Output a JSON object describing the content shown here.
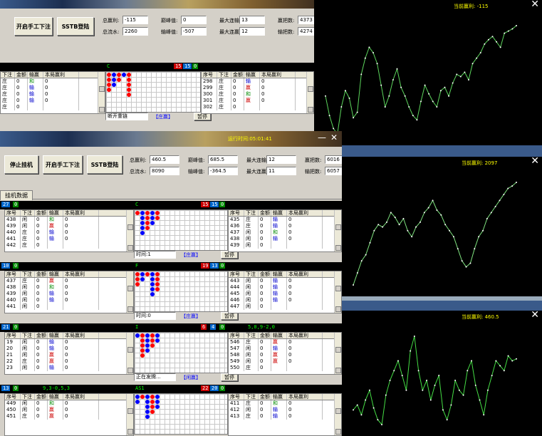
{
  "w1": {
    "buttons": [
      "开启手工下注",
      "SSTB登陆"
    ],
    "stats": [
      {
        "l": "总赢利:",
        "v": "-115"
      },
      {
        "l": "巅峰值:",
        "v": "0"
      },
      {
        "l": "最大连输:",
        "v": "13"
      },
      {
        "l": "赢把数:",
        "v": "4373"
      },
      {
        "l": "总流水:",
        "v": "2260"
      },
      {
        "l": "输峰值:",
        "v": "-507"
      },
      {
        "l": "最大连赢:",
        "v": "12"
      },
      {
        "l": "输把数:",
        "v": "4274"
      }
    ],
    "sections": [
      {
        "left_title": "",
        "cols": [
          "下注",
          "金额",
          "输赢",
          "本局赢利"
        ],
        "rows": [
          [
            "庄",
            "0",
            "和",
            "0"
          ],
          [
            "庄",
            "0",
            "输",
            "0"
          ],
          [
            "庄",
            "0",
            "输",
            "0"
          ],
          [
            "庄",
            "0",
            "输",
            "0"
          ],
          [
            "庄",
            "0",
            "",
            ""
          ]
        ],
        "mid_label": "C",
        "n1": "15",
        "n2": "15",
        "n3": "0",
        "status": "断开重链",
        "bet": "【庄赢】",
        "pause": "暂停",
        "right_title": "",
        "rcols": [
          "序号",
          "下注",
          "金额",
          "输赢",
          "本局赢利"
        ],
        "rrows": [
          [
            "298",
            "庄",
            "0",
            "输",
            "0"
          ],
          [
            "299",
            "庄",
            "0",
            "赢",
            "0"
          ],
          [
            "300",
            "庄",
            "0",
            "和",
            "0"
          ],
          [
            "301",
            "庄",
            "0",
            "赢",
            "0"
          ],
          [
            "302",
            "庄",
            "0",
            "",
            ""
          ]
        ]
      }
    ]
  },
  "w2": {
    "title": "运行时间:05:01:41",
    "buttons": [
      "停止挂机",
      "开启手工下注",
      "SSTB登陆"
    ],
    "stats": [
      {
        "l": "总赢利:",
        "v": "460.5"
      },
      {
        "l": "巅峰值:",
        "v": "685.5"
      },
      {
        "l": "最大连输:",
        "v": "12"
      },
      {
        "l": "赢把数:",
        "v": "6016"
      },
      {
        "l": "总流水:",
        "v": "8090"
      },
      {
        "l": "输峰值:",
        "v": "-364.5"
      },
      {
        "l": "最大连赢:",
        "v": "11"
      },
      {
        "l": "输把数:",
        "v": "6057"
      }
    ],
    "tab": "挂机数据",
    "sections": [
      {
        "left_badge": "27",
        "left_badge2": "0",
        "cols": [
          "序号",
          "下注",
          "金额",
          "输赢",
          "本局赢利"
        ],
        "rows": [
          [
            "438",
            "闲",
            "0",
            "和",
            "0"
          ],
          [
            "439",
            "闲",
            "0",
            "赢",
            "0"
          ],
          [
            "440",
            "庄",
            "0",
            "输",
            "0"
          ],
          [
            "441",
            "庄",
            "0",
            "输",
            "0"
          ],
          [
            "442",
            "庄",
            "0",
            "",
            ""
          ]
        ],
        "mid_label": "C",
        "n1": "15",
        "n2": "15",
        "n3": "0",
        "status": "时间:1",
        "bet": "【庄赢】",
        "pause": "暂停",
        "rcols": [
          "序号",
          "下注",
          "金额",
          "输赢",
          "本局赢利"
        ],
        "rrows": [
          [
            "435",
            "庄",
            "0",
            "输",
            "0"
          ],
          [
            "436",
            "庄",
            "0",
            "输",
            "0"
          ],
          [
            "437",
            "闲",
            "0",
            "和",
            "0"
          ],
          [
            "438",
            "闲",
            "0",
            "输",
            "0"
          ],
          [
            "439",
            "闲",
            "0",
            "",
            ""
          ]
        ]
      },
      {
        "left_badge": "10",
        "left_badge2": "0",
        "cols": [
          "序号",
          "下注",
          "金额",
          "输赢",
          "本局赢利"
        ],
        "rows": [
          [
            "437",
            "庄",
            "0",
            "赢",
            "0"
          ],
          [
            "438",
            "闲",
            "0",
            "和",
            "0"
          ],
          [
            "439",
            "闲",
            "0",
            "输",
            "0"
          ],
          [
            "440",
            "闲",
            "0",
            "输",
            "0"
          ],
          [
            "441",
            "闲",
            "0",
            "",
            ""
          ]
        ],
        "mid_label": "F",
        "n1": "19",
        "n2": "13",
        "n3": "0",
        "status": "时间:0",
        "bet": "【庄赢】",
        "pause": "暂停",
        "rcols": [
          "序号",
          "下注",
          "金额",
          "输赢",
          "本局赢利"
        ],
        "rrows": [
          [
            "443",
            "闲",
            "0",
            "输",
            "0"
          ],
          [
            "444",
            "闲",
            "0",
            "输",
            "0"
          ],
          [
            "445",
            "闲",
            "0",
            "输",
            "0"
          ],
          [
            "446",
            "闲",
            "0",
            "输",
            "0"
          ],
          [
            "447",
            "闲",
            "0",
            "",
            ""
          ]
        ]
      },
      {
        "left_badge": "21",
        "left_badge2": "0",
        "cols": [
          "序号",
          "下注",
          "金额",
          "输赢",
          "本局赢利"
        ],
        "rows": [
          [
            "19",
            "闲",
            "0",
            "输",
            "0"
          ],
          [
            "20",
            "闲",
            "0",
            "输",
            "0"
          ],
          [
            "21",
            "闲",
            "0",
            "赢",
            "0"
          ],
          [
            "22",
            "庄",
            "0",
            "赢",
            "0"
          ],
          [
            "23",
            "闲",
            "0",
            "输",
            "0"
          ]
        ],
        "mid_label": "I",
        "n1": "6",
        "n2": "4",
        "n3": "0",
        "status": "正在发牌...",
        "bet": "【闲赢】",
        "pause": "暂停",
        "right_title": "5,0,9-2,0",
        "rcols": [
          "序号",
          "下注",
          "金额",
          "输赢",
          "本局赢利"
        ],
        "rrows": [
          [
            "546",
            "庄",
            "0",
            "赢",
            "0"
          ],
          [
            "547",
            "闲",
            "0",
            "输",
            "0"
          ],
          [
            "548",
            "闲",
            "0",
            "赢",
            "0"
          ],
          [
            "549",
            "闲",
            "0",
            "赢",
            "0"
          ],
          [
            "550",
            "庄",
            "0",
            "",
            ""
          ]
        ]
      },
      {
        "left_badge": "13",
        "left_badge2": "0",
        "left_title": "9,3-0,5,3",
        "cols": [
          "序号",
          "下注",
          "金额",
          "输赢",
          "本局赢利"
        ],
        "rows": [
          [
            "449",
            "闲",
            "0",
            "和",
            "0"
          ],
          [
            "450",
            "闲",
            "0",
            "赢",
            "0"
          ],
          [
            "451",
            "庄",
            "0",
            "赢",
            "0"
          ]
        ],
        "mid_label": "AS1",
        "n1": "22",
        "n2": "20",
        "n3": "0",
        "rcols": [
          "序号",
          "下注",
          "金额",
          "输赢",
          "本局赢利"
        ],
        "rrows": [
          [
            "411",
            "庄",
            "0",
            "和",
            "0"
          ],
          [
            "412",
            "闲",
            "0",
            "输",
            "0"
          ],
          [
            "413",
            "庄",
            "0",
            "输",
            "0"
          ]
        ]
      }
    ]
  },
  "charts": [
    {
      "title": "当前赢利: -115",
      "close": "✕",
      "color": "#5cd65c",
      "values": [
        40,
        22,
        10,
        5,
        30,
        45,
        38,
        20,
        25,
        60,
        75,
        85,
        80,
        70,
        50,
        30,
        40,
        55,
        65,
        48,
        40,
        30,
        22,
        18,
        35,
        50,
        42,
        35,
        30,
        45,
        48,
        40,
        52,
        60,
        58,
        62,
        55,
        70,
        75,
        80,
        88,
        92,
        95,
        90,
        85,
        98,
        100,
        102,
        105
      ]
    },
    {
      "title": "当前赢利: 2097",
      "close": "✕",
      "color": "#7ee27e",
      "values": [
        10,
        20,
        30,
        35,
        45,
        55,
        60,
        58,
        62,
        70,
        66,
        60,
        65,
        55,
        50,
        58,
        62,
        70,
        74,
        80,
        72,
        68,
        60,
        55,
        50,
        40,
        30,
        25,
        28,
        40,
        50,
        55,
        65,
        70,
        75,
        80,
        85,
        90,
        92,
        95
      ]
    },
    {
      "title": "当前赢利: 460.5",
      "close": "✕",
      "color": "#44dd44",
      "values": [
        20,
        25,
        15,
        30,
        40,
        22,
        10,
        5,
        35,
        50,
        60,
        70,
        55,
        40,
        80,
        95,
        60,
        40,
        50,
        30,
        45,
        55,
        20,
        10,
        25,
        50,
        40,
        35,
        60,
        70,
        45,
        30,
        15,
        40,
        55,
        70,
        65,
        60,
        75,
        70,
        72
      ]
    }
  ]
}
